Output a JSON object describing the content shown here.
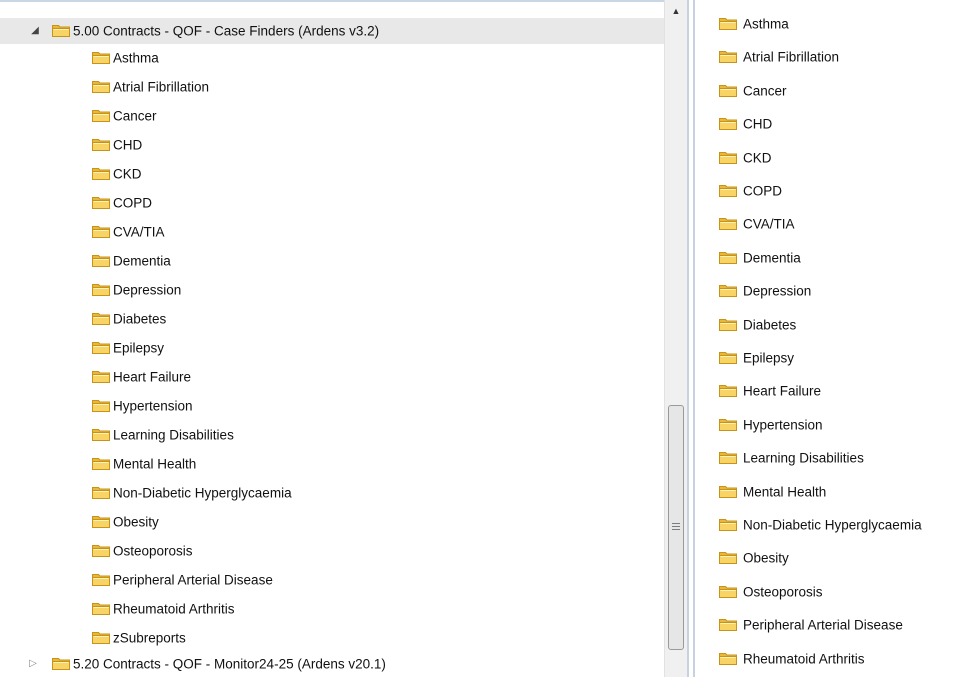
{
  "tree": {
    "parent": {
      "label": "5.00 Contracts - QOF - Case Finders (Ardens v3.2)",
      "expanded": true,
      "children": [
        "Asthma",
        "Atrial Fibrillation",
        "Cancer",
        "CHD",
        "CKD",
        "COPD",
        "CVA/TIA",
        "Dementia",
        "Depression",
        "Diabetes",
        "Epilepsy",
        "Heart Failure",
        "Hypertension",
        "Learning Disabilities",
        "Mental Health",
        "Non-Diabetic Hyperglycaemia",
        "Obesity",
        "Osteoporosis",
        "Peripheral Arterial Disease",
        "Rheumatoid Arthritis",
        "zSubreports"
      ]
    },
    "sibling": {
      "label": "5.20 Contracts - QOF - Monitor24-25 (Ardens v20.1)",
      "expanded": false
    }
  },
  "list": {
    "items": [
      "Asthma",
      "Atrial Fibrillation",
      "Cancer",
      "CHD",
      "CKD",
      "COPD",
      "CVA/TIA",
      "Dementia",
      "Depression",
      "Diabetes",
      "Epilepsy",
      "Heart Failure",
      "Hypertension",
      "Learning Disabilities",
      "Mental Health",
      "Non-Diabetic Hyperglycaemia",
      "Obesity",
      "Osteoporosis",
      "Peripheral Arterial Disease",
      "Rheumatoid Arthritis"
    ]
  },
  "icons": {
    "folder": "folder-icon",
    "expanded": "expanded-triangle-icon",
    "collapsed": "collapsed-triangle-icon",
    "scroll_up": "scroll-up-arrow-icon",
    "grip": "scroll-grip-icon"
  },
  "colors": {
    "folder_fill": "#f6cf57",
    "folder_dark": "#d9a520",
    "selected_row": "#e8e8e8",
    "splitter": "#c7d2e0"
  }
}
